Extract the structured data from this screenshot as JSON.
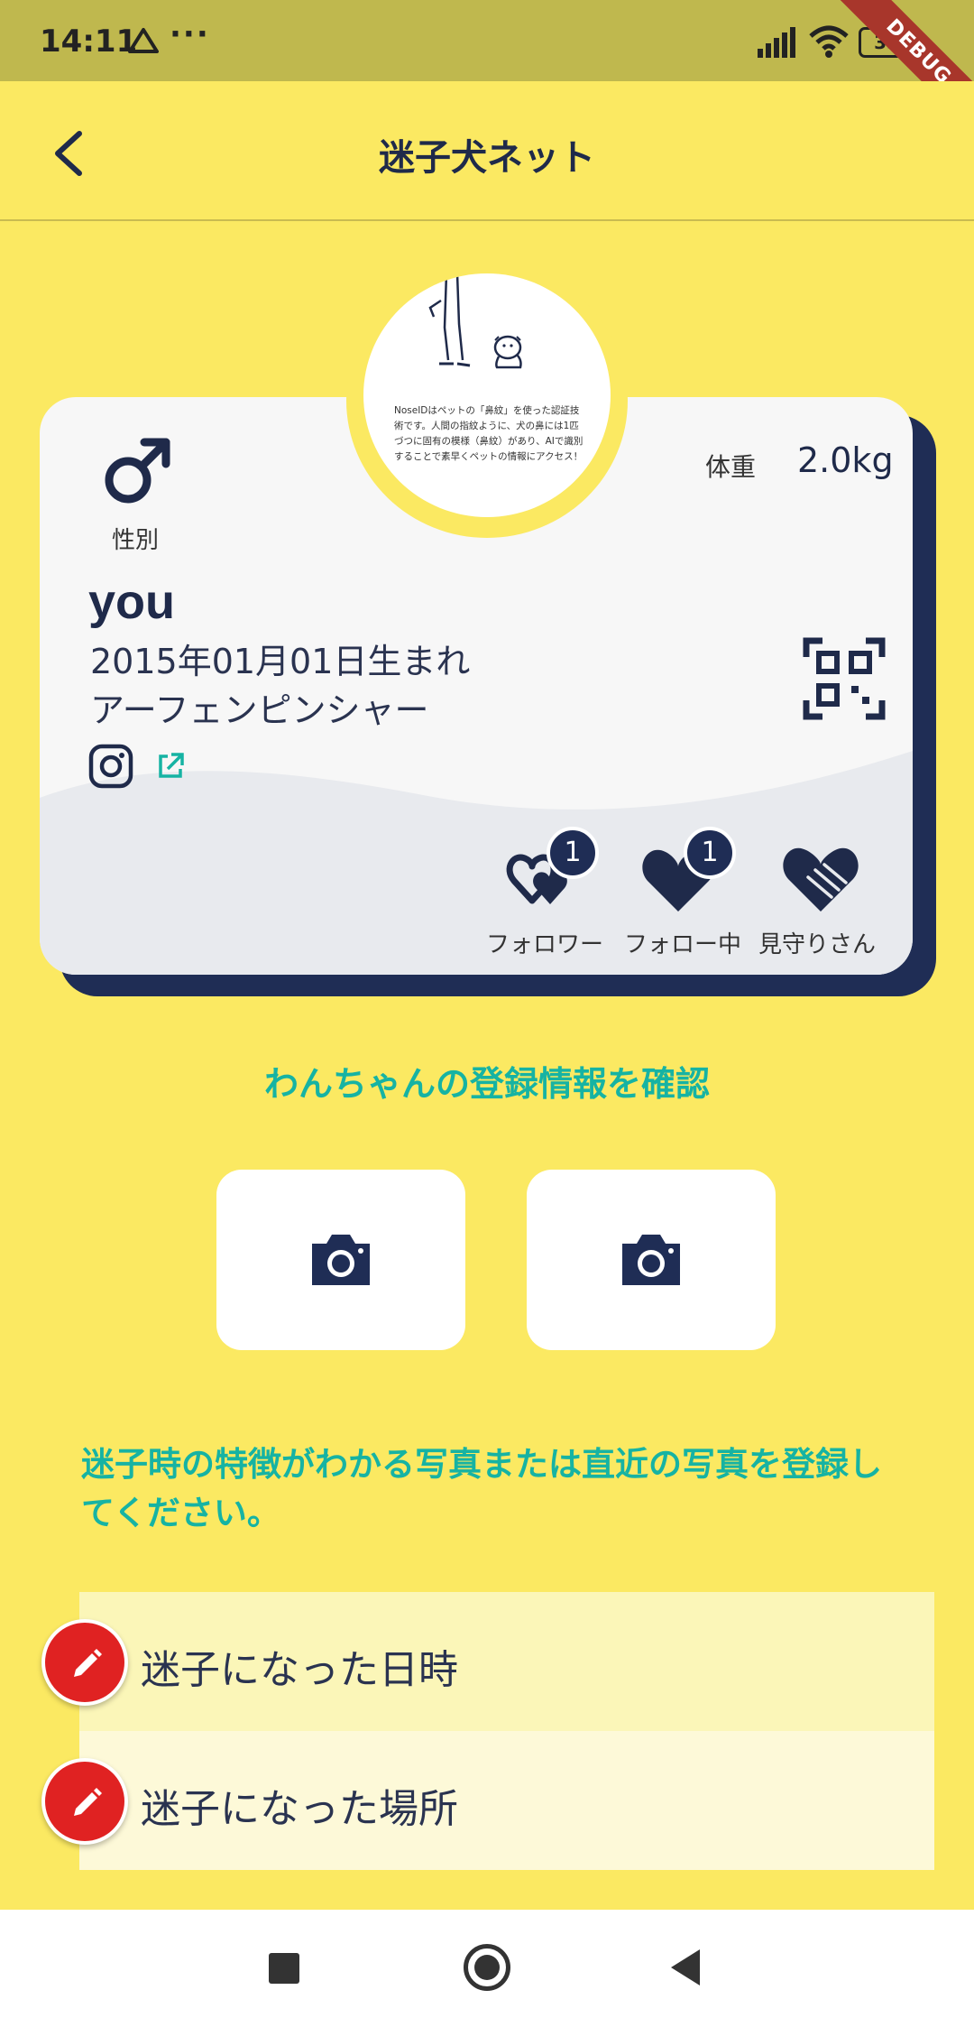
{
  "status_bar": {
    "time": "14:11",
    "dots": "···",
    "battery": "35",
    "debug_banner": "DEBUG"
  },
  "header": {
    "title": "迷子犬ネット"
  },
  "profile_card": {
    "avatar_text": "NoseIDはペットの「鼻紋」を使った認証技術です。人間の指紋ように、犬の鼻には1匹 づつに固有の模様（鼻紋）があり、AIで識別することで素早くペットの情報にアクセス！",
    "gender_symbol": "♂",
    "gender_label": "性別",
    "weight_label": "体重",
    "weight_value": "2.0kg",
    "name": "you",
    "birth": "2015年01月01日生まれ",
    "breed": "アーフェンピンシャー",
    "stats": [
      {
        "label": "フォロワー",
        "count": "1",
        "icon": "hearts-icon"
      },
      {
        "label": "フォロー中",
        "count": "1",
        "icon": "heart-icon"
      },
      {
        "label": "見守りさん",
        "icon": "handshake-heart-icon"
      }
    ]
  },
  "confirm_link": "わんちゃんの登録情報を確認",
  "photo_slots": [
    {
      "icon": "camera-icon"
    },
    {
      "icon": "camera-icon"
    }
  ],
  "instruction": "迷子時の特徴がわかる写真または直近の写真を登録してください。",
  "fields": [
    {
      "label": "迷子になった日時",
      "icon": "pencil-icon"
    },
    {
      "label": "迷子になった場所",
      "icon": "pencil-icon"
    }
  ],
  "colors": {
    "background": "#fbe962",
    "status_bar": "#bfb84e",
    "navy": "#1f2d55",
    "teal": "#16b3a3",
    "red": "#e02222"
  }
}
